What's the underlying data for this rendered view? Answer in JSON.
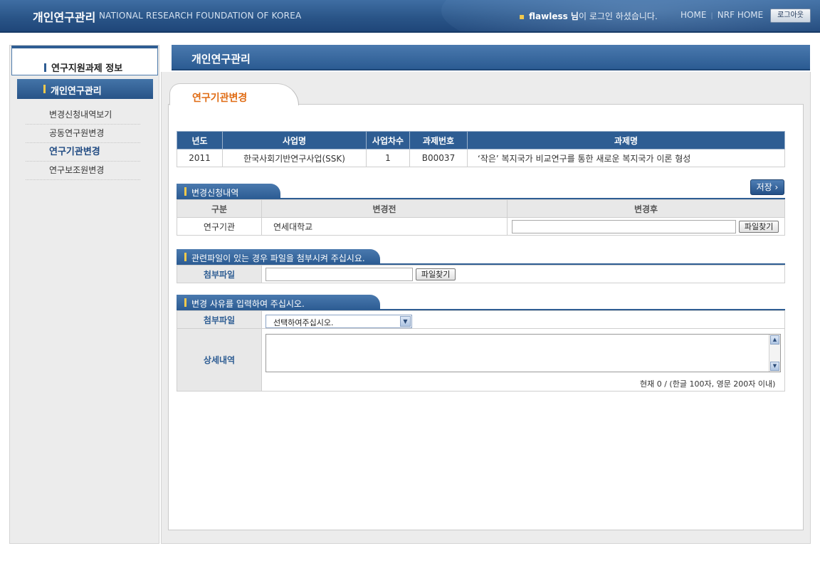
{
  "header": {
    "title_ko": "개인연구관리",
    "title_en": "NATIONAL RESEARCH FOUNDATION OF KOREA",
    "user_name": "flawless 님",
    "login_suffix": "이 로그인 하셨습니다.",
    "nav_home": "HOME",
    "nav_nrf_home": "NRF HOME",
    "logout_label": "로그아웃"
  },
  "sidebar": {
    "section_title": "연구지원과제 정보",
    "active_menu": "개인연구관리",
    "items": [
      {
        "label": "변경신청내역보기"
      },
      {
        "label": "공동연구원변경"
      },
      {
        "label": "연구기관변경"
      },
      {
        "label": "연구보조원변경"
      }
    ]
  },
  "main": {
    "title": "개인연구관리",
    "tab_label": "연구기관변경"
  },
  "project_table": {
    "headers": [
      "년도",
      "사업명",
      "사업차수",
      "과제번호",
      "과제명"
    ],
    "row": [
      "2011",
      "한국사회기반연구사업(SSK)",
      "1",
      "B00037",
      "‘작은’ 복지국가 비교연구를 통한 새로운 복지국가 이론 형성"
    ]
  },
  "change_section": {
    "header": "변경신청내역",
    "save_label": "저장",
    "headers": [
      "구분",
      "변경전",
      "변경후"
    ],
    "row_label": "연구기관",
    "before_value": "연세대학교",
    "after_value": "",
    "file_button": "파일찾기"
  },
  "attach_section": {
    "header": "관련파일이 있는 경우 파일을 첨부시켜 주십시요.",
    "label": "첨부파일",
    "file_value": "",
    "file_button": "파일찾기"
  },
  "reason_section": {
    "header": "변경 사유를 입력하여 주십시오.",
    "select_label": "첨부파일",
    "select_value": "선택하여주십시오.",
    "detail_label": "상세내역",
    "detail_value": "",
    "char_count": "현재 0 / (한글 100자, 영문 200자 이내)"
  },
  "colors": {
    "header_blue": "#2a5588",
    "accent_orange": "#e06c14",
    "label_blue": "#2e5d93",
    "marker_yellow": "#f2c94c"
  }
}
